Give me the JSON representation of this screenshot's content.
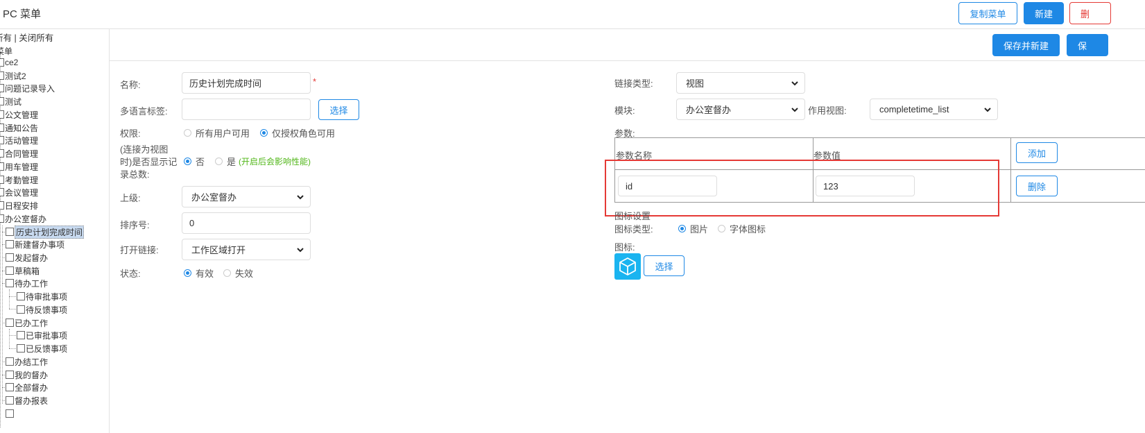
{
  "header": {
    "title": "PC 菜单",
    "copy_menu": "复制菜单",
    "new": "新建",
    "delete": "删"
  },
  "sidebar": {
    "expand_collapse": "所有 | 关闭所有",
    "root": "菜单",
    "top_items": [
      "ce2",
      "测试2",
      "问题记录导入",
      "测试",
      "公文管理",
      "通知公告",
      "活动管理",
      "合同管理",
      "用车管理",
      "考勤管理",
      "会议管理",
      "日程安排",
      "办公室督办"
    ],
    "sub_items": {
      "history": "历史计划完成时间",
      "new_task": "新建督办事项",
      "launch": "发起督办",
      "draft": "草稿箱",
      "todo": "待办工作",
      "todo_approve": "待审批事项",
      "todo_feedback": "待反馈事项",
      "done": "已办工作",
      "done_approve": "已审批事项",
      "done_feedback": "已反馈事项",
      "finished": "办结工作",
      "mine": "我的督办",
      "all": "全部督办",
      "report": "督办报表"
    }
  },
  "toolbar": {
    "save_and_new": "保存并新建",
    "save": "保"
  },
  "form_left": {
    "name_label": "名称:",
    "name_value": "历史计划完成时间",
    "required_mark": "*",
    "i18n_label": "多语言标签:",
    "i18n_value": "",
    "select_button": "选择",
    "permission_label": "权限:",
    "permission_all": "所有用户可用",
    "permission_auth": "仅授权角色可用",
    "show_count_label": "(连接为视图时)是否显示记录总数:",
    "no": "否",
    "yes": "是",
    "yes_hint": "(开启后会影响性能)",
    "parent_label": "上级:",
    "parent_value": "办公室督办",
    "order_label": "排序号:",
    "order_value": "0",
    "open_link_label": "打开链接:",
    "open_link_value": "工作区域打开",
    "status_label": "状态:",
    "status_valid": "有效",
    "status_invalid": "失效"
  },
  "form_right": {
    "link_type_label": "链接类型:",
    "link_type_value": "视图",
    "module_label": "模块:",
    "module_value": "办公室督办",
    "view_label": "作用视图:",
    "view_value": "completetime_list",
    "params_label": "参数:",
    "params_header_name": "参数名称",
    "params_header_value": "参数值",
    "add_button": "添加",
    "param_name": "id",
    "param_value": "123",
    "delete_button": "删除",
    "icon_settings": "图标设置",
    "icon_type_label": "图标类型:",
    "icon_type_image": "图片",
    "icon_type_font": "字体图标",
    "icon_label": "图标:",
    "icon_select_button": "选择",
    "icon_name": "cube-icon"
  },
  "colors": {
    "accent": "#1e88e5",
    "danger": "#e53935",
    "hint_green": "#52b71a",
    "icon_tile": "#1ab4f0"
  }
}
